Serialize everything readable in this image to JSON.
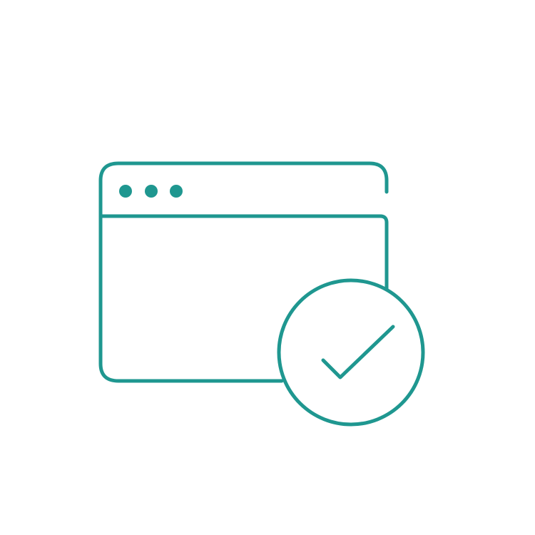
{
  "illustration": {
    "icon": "browser-window-check-icon",
    "stroke_color": "#1f9790",
    "background_color": "#ffffff",
    "window_controls": [
      "dot",
      "dot",
      "dot"
    ],
    "badge_icon": "checkmark-icon"
  }
}
